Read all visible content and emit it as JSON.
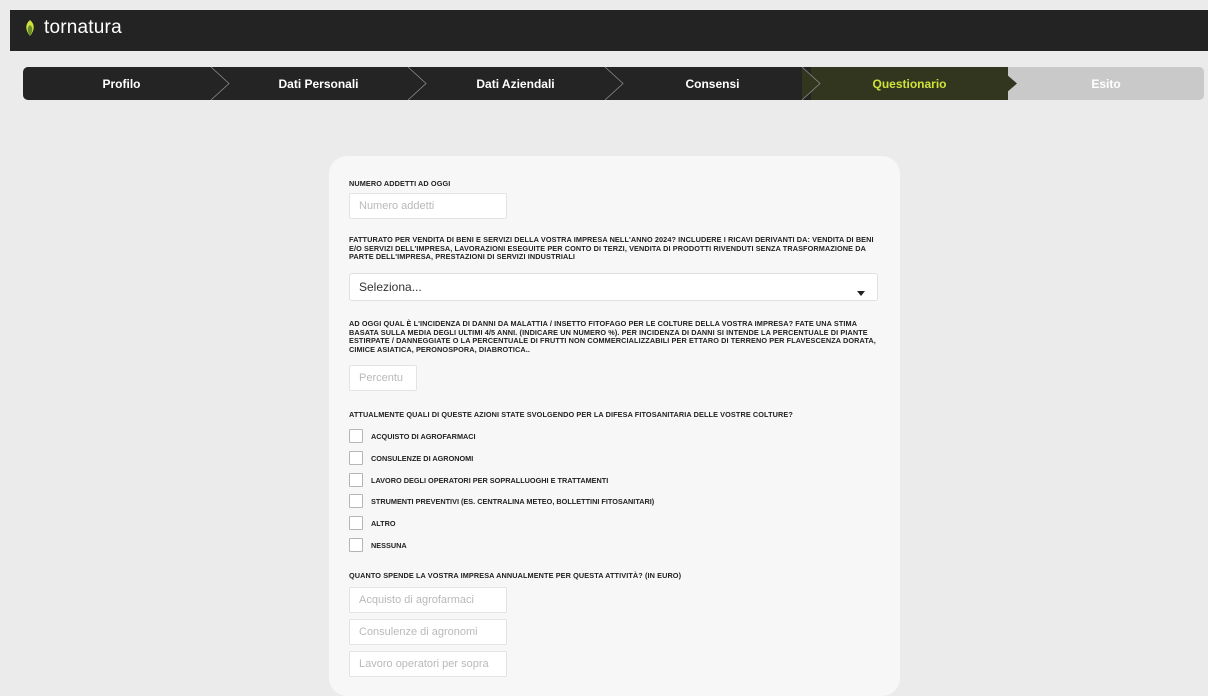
{
  "brand": {
    "name": "tornatura",
    "icon": "leaf-logo-icon",
    "accent": "#cfe23a"
  },
  "steps": [
    {
      "label": "Profilo",
      "state": "done"
    },
    {
      "label": "Dati Personali",
      "state": "done"
    },
    {
      "label": "Dati Aziendali",
      "state": "done"
    },
    {
      "label": "Consensi",
      "state": "done"
    },
    {
      "label": "Questionario",
      "state": "active"
    },
    {
      "label": "Esito",
      "state": "pending"
    }
  ],
  "form": {
    "employees": {
      "label": "NUMERO ADDETTI AD OGGI",
      "placeholder": "Numero addetti"
    },
    "revenue": {
      "label": "FATTURATO PER VENDITA DI BENI E SERVIZI DELLA VOSTRA IMPRESA NELL'ANNO 2024? INCLUDERE I RICAVI DERIVANTI DA: VENDITA DI BENI E/O SERVIZI DELL'IMPRESA, LAVORAZIONI ESEGUITE PER CONTO DI TERZI, VENDITA DI PRODOTTI RIVENDUTI SENZA TRASFORMAZIONE DA PARTE DELL'IMPRESA, PRESTAZIONI DI SERVIZI INDUSTRIALI",
      "selected": "Seleziona..."
    },
    "damage": {
      "label": "AD OGGI QUAL È L'INCIDENZA DI DANNI DA MALATTIA / INSETTO FITOFAGO PER LE COLTURE DELLA VOSTRA IMPRESA? FATE UNA STIMA BASATA SULLA MEDIA DEGLI ULTIMI 4/5 ANNI. (INDICARE UN NUMERO %). PER INCIDENZA DI DANNI SI INTENDE LA PERCENTUALE DI PIANTE ESTIRPATE / DANNEGGIATE O LA PERCENTUALE DI FRUTTI NON COMMERCIALIZZABILI PER ETTARO DI TERRENO PER FLAVESCENZA DORATA, CIMICE ASIATICA, PERONOSPORA, DIABROTICA..",
      "placeholder": "Percentu"
    },
    "actions": {
      "label": "ATTUALMENTE QUALI DI QUESTE AZIONI STATE SVOLGENDO PER LA DIFESA FITOSANITARIA DELLE VOSTRE COLTURE?",
      "options": [
        "ACQUISTO DI AGROFARMACI",
        "CONSULENZE DI AGRONOMI",
        "LAVORO DEGLI OPERATORI PER SOPRALLUOGHI E TRATTAMENTI",
        "STRUMENTI PREVENTIVI (ES. CENTRALINA METEO, BOLLETTINI FITOSANITARI)",
        "ALTRO",
        "NESSUNA"
      ]
    },
    "spend": {
      "label": "QUANTO SPENDE LA VOSTRA IMPRESA ANNUALMENTE PER QUESTA ATTIVITÀ? (IN EURO)",
      "placeholders": [
        "Acquisto di agrofarmaci",
        "Consulenze di agronomi",
        "Lavoro operatori per sopra"
      ]
    }
  }
}
